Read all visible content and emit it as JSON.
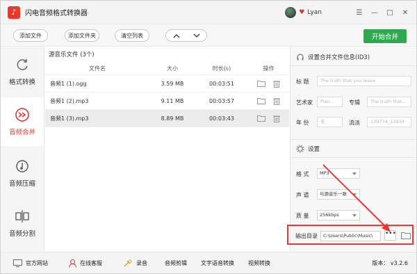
{
  "app": {
    "title": "闪电音频格式转换器",
    "logo_glyph": "♪"
  },
  "user": {
    "name": "Lyan"
  },
  "window_controls": [
    "☰",
    "—",
    "□",
    "✕"
  ],
  "toolbar": {
    "add_file": "添加文件",
    "add_folder": "添加文件夹",
    "clear_list": "清空列表",
    "move_up": "▲",
    "move_down": "▼",
    "start_merge": "开始合并"
  },
  "sidebar": {
    "items": [
      {
        "label": "格式转换",
        "icon": "refresh-icon",
        "active": false
      },
      {
        "label": "音频合并",
        "icon": "merge-icon",
        "active": true
      },
      {
        "label": "音频压缩",
        "icon": "compress-icon",
        "active": false
      },
      {
        "label": "音频分割",
        "icon": "split-icon",
        "active": false
      }
    ]
  },
  "file_list": {
    "header": "源音乐文件 (3个)",
    "columns": {
      "name": "文件名",
      "size": "大小",
      "duration": "时长(s)",
      "actions": "操作"
    },
    "rows": [
      {
        "name": "音频1 (1).ogg",
        "size": "3.59 MB",
        "duration": "00:03:51"
      },
      {
        "name": "音频1 (2).mp3",
        "size": "9.11 MB",
        "duration": "00:03:57"
      },
      {
        "name": "音频1 (3).mp3",
        "size": "8.89 MB",
        "duration": "00:03:43"
      }
    ]
  },
  "id3": {
    "title": "设置合并文件信息(ID3)",
    "title_label": "标  题",
    "title_placeholder": "The truth that you leave",
    "artist_label": "艺术家",
    "artist_placeholder": "Pian...",
    "album_label": "专辑",
    "album_placeholder": "The truth that...",
    "year_label": "年  份",
    "year_placeholder": "无",
    "genre_label": "流派",
    "genre_placeholder": "139774_13934"
  },
  "settings": {
    "title": "设置",
    "format_label": "格  式",
    "format_value": "MP3",
    "channel_label": "声  道",
    "channel_value": "与源音乐一致",
    "quality_label": "质  量",
    "quality_value": "256kbps",
    "output_label": "输出目录",
    "output_path": "C:\\Users\\Public\\Music\\",
    "browse": "•••"
  },
  "statusbar": {
    "website": "官方网站",
    "support": "在线客服",
    "record": "录音",
    "edit": "音频剪辑",
    "tts": "文字语音转换",
    "video": "视频转换",
    "version": "版本： v3.2.6"
  },
  "colors": {
    "accent": "#e0362c",
    "green": "#2fa84f",
    "highlight": "#e53935"
  }
}
